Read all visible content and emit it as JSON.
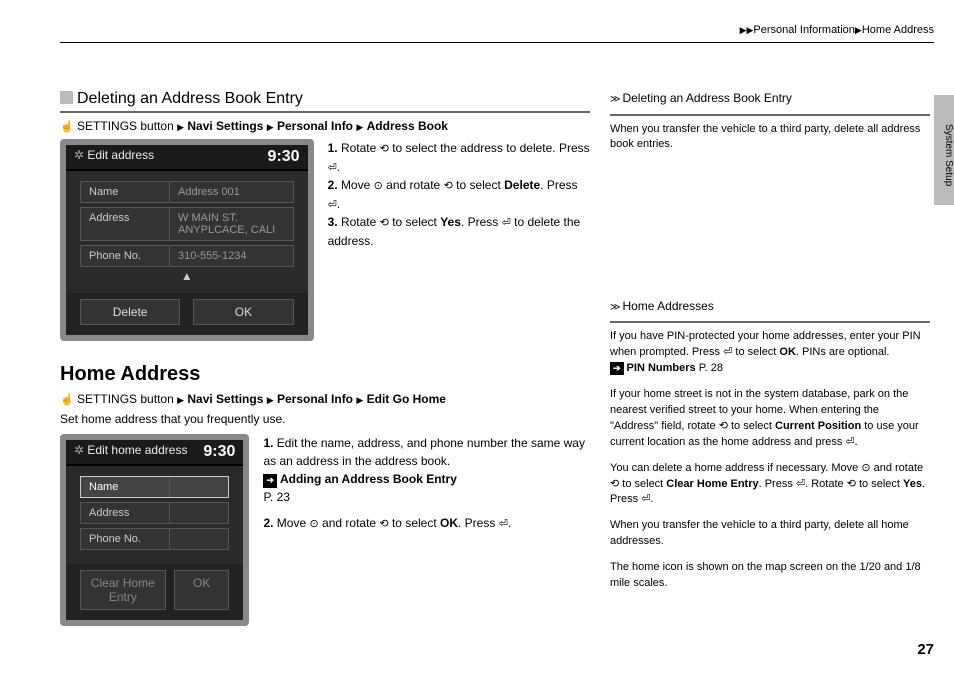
{
  "header": {
    "section": "Personal Information",
    "page": "Home Address"
  },
  "tab": "System Setup",
  "pageNumber": "27",
  "glyph": {
    "hand": "☝",
    "rotate": "⟲",
    "press": "⏎",
    "move": "⊙",
    "arrowBox": "➔"
  },
  "delSection": {
    "title": "Deleting an Address Book Entry",
    "breadcrumb": {
      "btn": "SETTINGS button",
      "a": "Navi Settings",
      "b": "Personal Info",
      "c": "Address Book"
    },
    "device": {
      "title": "Edit address",
      "time": "9:30",
      "fields": [
        {
          "label": "Name",
          "value": "Address 001",
          "sel": false
        },
        {
          "label": "Address",
          "value": "W MAIN ST. ANYPLCACE, CALI",
          "sel": false
        },
        {
          "label": "Phone No.",
          "value": "310-555-1234",
          "sel": false
        }
      ],
      "buttons": {
        "left": "Delete",
        "right": "OK"
      }
    },
    "steps": [
      {
        "n": "1.",
        "pre": "Rotate ",
        "mid": " to select the address to delete. Press ",
        "post": "."
      },
      {
        "n": "2.",
        "pre": "Move ",
        "mid1": " and rotate ",
        "mid2": " to select ",
        "bold": "Delete",
        "post": ". Press ",
        "tail": "."
      },
      {
        "n": "3.",
        "pre": "Rotate ",
        "mid": " to select ",
        "bold": "Yes",
        "post": ". Press ",
        "tail": " to delete the address."
      }
    ]
  },
  "homeSection": {
    "title": "Home Address",
    "breadcrumb": {
      "btn": "SETTINGS button",
      "a": "Navi Settings",
      "b": "Personal Info",
      "c": "Edit Go Home"
    },
    "intro": "Set home address that you frequently use.",
    "device": {
      "title": "Edit home address",
      "time": "9:30",
      "fields": [
        {
          "label": "Name",
          "value": "",
          "sel": true
        },
        {
          "label": "Address",
          "value": "",
          "sel": false
        },
        {
          "label": "Phone No.",
          "value": "",
          "sel": false
        }
      ],
      "buttons": {
        "left": "Clear Home Entry",
        "right": "OK"
      }
    },
    "steps": {
      "s1": {
        "n": "1.",
        "text": "Edit the name, address, and phone number the same way as an address in the address book."
      },
      "ref": {
        "label": "Adding an Address Book Entry",
        "page": "P. 23"
      },
      "s2": {
        "n": "2.",
        "pre": "Move ",
        "mid1": " and rotate ",
        "mid2": " to select ",
        "bold": "OK",
        "post": ". Press ",
        "tail": "."
      }
    }
  },
  "sidebar": {
    "box1": {
      "title": "Deleting an Address Book Entry",
      "p1": "When you transfer the vehicle to a third party, delete all address book entries."
    },
    "box2": {
      "title": "Home Addresses",
      "p1a": "If you have PIN-protected your home addresses, enter your PIN when prompted. Press ",
      "p1b": " to select ",
      "p1bold": "OK",
      "p1c": ". PINs are optional.",
      "ref": {
        "label": "PIN Numbers",
        "page": "P. 28"
      },
      "p2a": "If your home street is not in the system database, park on the nearest verified street to your home. When entering the \"Address\" field, rotate ",
      "p2b": " to select ",
      "p2bold": "Current Position",
      "p2c": " to use your current location as the home address and press ",
      "p2d": ".",
      "p3a": "You can delete a home address if necessary. Move ",
      "p3b": " and rotate ",
      "p3c": " to select ",
      "p3bold1": "Clear Home Entry",
      "p3d": ". Press ",
      "p3e": ". Rotate ",
      "p3f": " to select ",
      "p3bold2": "Yes",
      "p3g": ". Press ",
      "p3h": ".",
      "p4": "When you transfer the vehicle to a third party, delete all home addresses.",
      "p5": "The home icon is shown on the map screen on the 1/20 and 1/8 mile scales."
    }
  }
}
